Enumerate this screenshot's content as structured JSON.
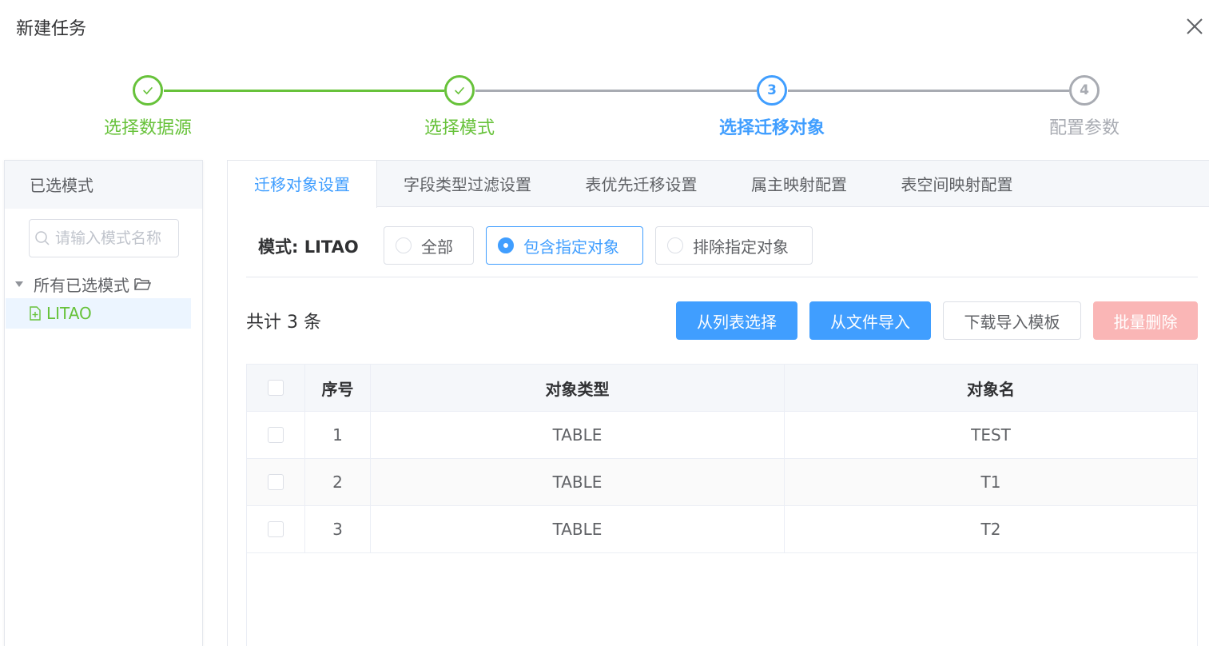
{
  "dialog": {
    "title": "新建任务"
  },
  "steps": [
    {
      "index": "1",
      "title": "选择数据源",
      "status": "done"
    },
    {
      "index": "2",
      "title": "选择模式",
      "status": "done"
    },
    {
      "index": "3",
      "title": "选择迁移对象",
      "status": "active"
    },
    {
      "index": "4",
      "title": "配置参数",
      "status": "wait"
    }
  ],
  "sidebar": {
    "header": "已选模式",
    "search_placeholder": "请输入模式名称",
    "tree_root_label": "所有已选模式",
    "tree_child_label": "LITAO"
  },
  "tabs": [
    {
      "label": "迁移对象设置",
      "active": true
    },
    {
      "label": "字段类型过滤设置",
      "active": false
    },
    {
      "label": "表优先迁移设置",
      "active": false
    },
    {
      "label": "属主映射配置",
      "active": false
    },
    {
      "label": "表空间映射配置",
      "active": false
    }
  ],
  "mode": {
    "label": "模式: LITAO",
    "options": [
      {
        "label": "全部",
        "checked": false
      },
      {
        "label": "包含指定对象",
        "checked": true
      },
      {
        "label": "排除指定对象",
        "checked": false
      }
    ]
  },
  "toolbar": {
    "total": "共计 3 条",
    "select_from_list": "从列表选择",
    "import_from_file": "从文件导入",
    "download_template": "下载导入模板",
    "batch_delete": "批量删除"
  },
  "table": {
    "headers": {
      "index": "序号",
      "type": "对象类型",
      "name": "对象名"
    },
    "rows": [
      {
        "index": "1",
        "type": "TABLE",
        "name": "TEST"
      },
      {
        "index": "2",
        "type": "TABLE",
        "name": "T1"
      },
      {
        "index": "3",
        "type": "TABLE",
        "name": "T2"
      }
    ]
  },
  "colors": {
    "primary": "#409eff",
    "success": "#67c23a",
    "inactive": "#a8abb2",
    "danger_disabled": "#fab6b6"
  }
}
